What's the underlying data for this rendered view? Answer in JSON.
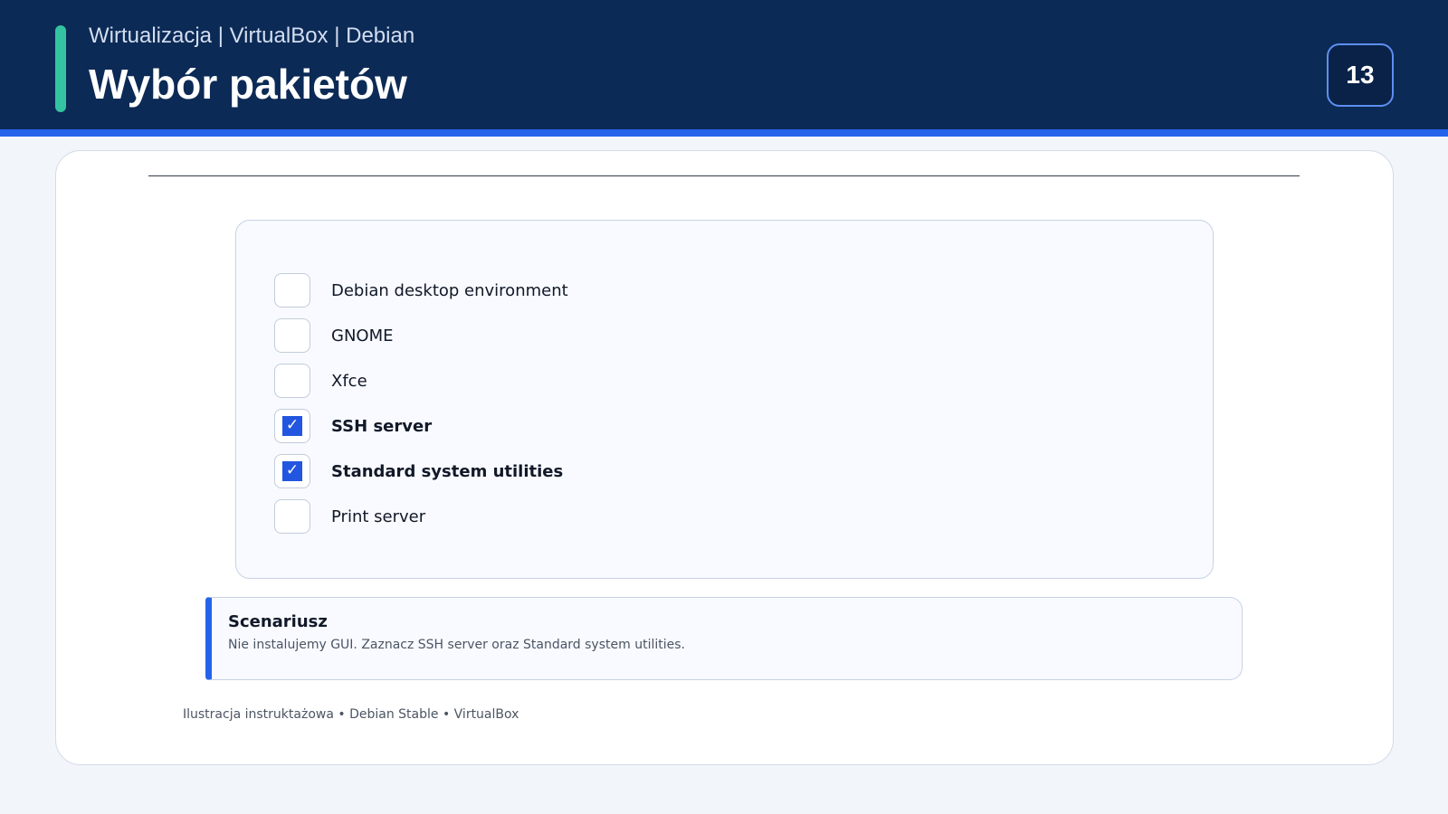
{
  "header": {
    "subtitle": "Wirtualizacja | VirtualBox | Debian",
    "title": "Wybór pakietów",
    "page_number": "13"
  },
  "options": [
    {
      "label": "Debian desktop environment",
      "checked": false
    },
    {
      "label": "GNOME",
      "checked": false
    },
    {
      "label": "Xfce",
      "checked": false
    },
    {
      "label": "SSH server",
      "checked": true
    },
    {
      "label": "Standard system utilities",
      "checked": true
    },
    {
      "label": "Print server",
      "checked": false
    }
  ],
  "tick_glyph": "✓",
  "note": {
    "title": "Scenariusz",
    "text": "Nie instalujemy GUI. Zaznacz SSH server oraz Standard system utilities."
  },
  "footer": {
    "caption": "Ilustracja instruktażowa • Debian Stable • VirtualBox"
  },
  "colors": {
    "header_bg": "#0c2a56",
    "accent_green": "#34c3a0",
    "accent_blue": "#2563eb",
    "checkbox_checked": "#2256e0"
  }
}
